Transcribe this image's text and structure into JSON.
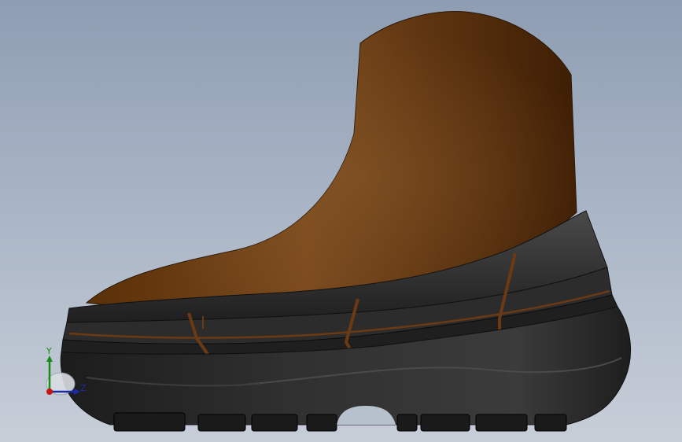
{
  "viewport": {
    "background_top": "#8e9db2",
    "background_bottom": "#c7ced8"
  },
  "model": {
    "icon": "boot-3d-model",
    "upper_color": "#6b3e18",
    "sole_color": "#2b2b2b"
  },
  "triad": {
    "icon": "coordinate-triad-icon",
    "y_label": "Y",
    "z_label": "Z",
    "y_color": "#1a8a1a",
    "z_color": "#1b2aa8",
    "origin_color": "#cc1111"
  }
}
